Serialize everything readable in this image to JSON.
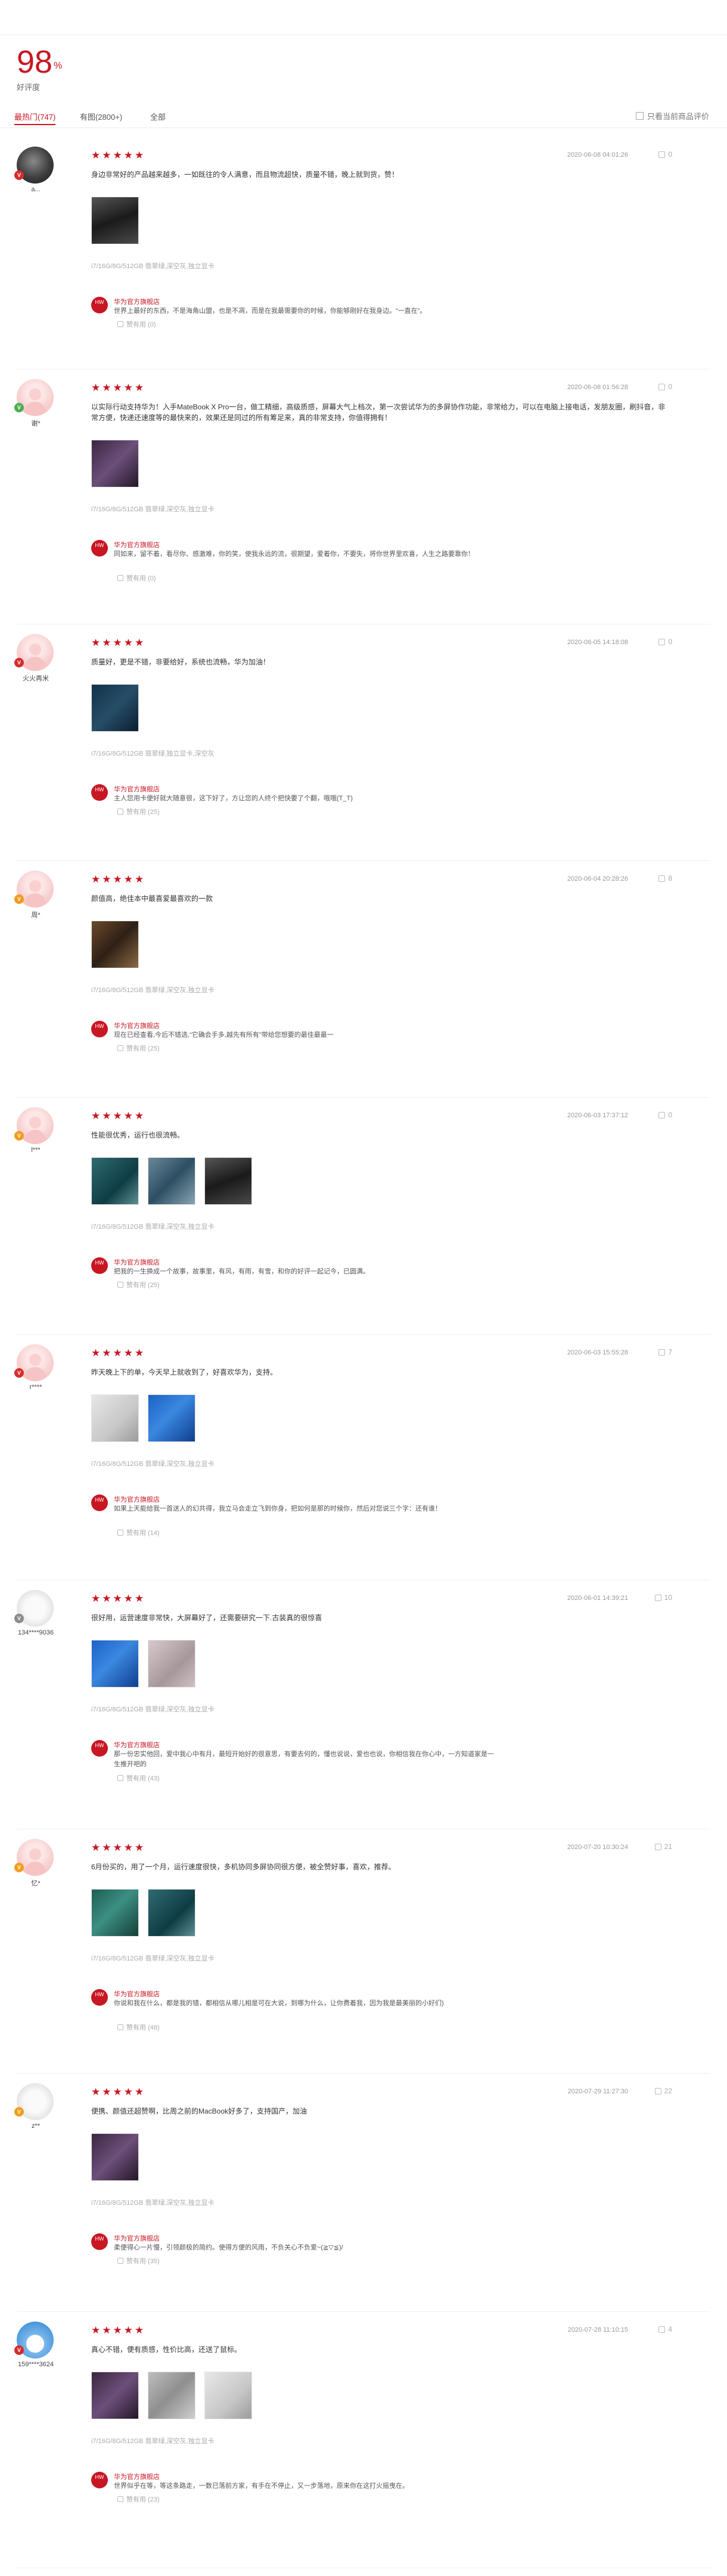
{
  "summary": {
    "rate": "98",
    "unit": "%",
    "label": "好评度"
  },
  "filters": {
    "items": [
      "最热门(747)",
      "有图(2800+)",
      "全部"
    ],
    "only_current": "只看当前商品评价"
  },
  "colors": {
    "accent": "#c81623"
  },
  "reviews": [
    {
      "username": "a...",
      "badge": "V",
      "rating": 5,
      "date": "2020-06-08 04:01:26",
      "likes": "0",
      "content": "身边非常好的产品越来越多，一如既往的令人满意，而且物流超快，质量不错，晚上就到货，赞！",
      "photo_count": 1,
      "meta": "i7/16G/8G/512GB 翡翠绿,深空灰,独立显卡",
      "reply_name": "华为官方旗舰店",
      "reply_text": "世界上最好的东西，不是海角山盟，也是不凋，而是在我最需要你的时候，你能够刚好在我身边。“一直在”。",
      "reply_likes": "赞有用 (0)"
    },
    {
      "username": "谢*",
      "badge": "V",
      "rating": 5,
      "date": "2020-06-08 01:56:28",
      "likes": "0",
      "content": "以实际行动支持华为！入手MateBook X Pro一台，做工精细，高级质感，屏幕大气上档次，第一次尝试华为的多屏协作功能，非常给力，可以在电脑上接电话，发朋友圈，刷抖音，非常方便，快递还速度等的最快来的，效果还是同过的所有筹足来，真的非常支持，你值得拥有！",
      "photo_count": 1,
      "meta": "i7/16G/8G/512GB 翡翠绿,深空灰,独立显卡",
      "reply_name": "华为官方旗舰店",
      "reply_text": "同如来，留不着，看尽你、感激难，你的笑，使我永远的流，很期望，爱着你，不要失，将你世界里欢喜，人生之路要靠你！",
      "reply_likes": "赞有用 (0)"
    },
    {
      "username": "火火再米",
      "badge": "V",
      "rating": 5,
      "date": "2020-06-05 14:18:08",
      "likes": "0",
      "content": "质量好，更是不错，非要给好，系统也流畅，华为加油！",
      "photo_count": 1,
      "meta": "i7/16G/8G/512GB 翡翠绿,独立显卡,深空灰",
      "reply_name": "华为官方旗舰店",
      "reply_text": "主人您用卡便好就大随意很，这下好了，方让您的人终个把快要了个翻，哦哦(T_T)",
      "reply_likes": "赞有用 (25)"
    },
    {
      "username": "周*",
      "badge": "V",
      "rating": 5,
      "date": "2020-06-04 20:28:26",
      "likes": "8",
      "content": "颜值高，绝佳本中最喜爱最喜欢的一款",
      "photo_count": 1,
      "meta": "i7/16G/8G/512GB 翡翠绿,深空灰,独立显卡",
      "reply_name": "华为官方旗舰店",
      "reply_text": "现在已经查看,今后不错选,“它确会手多,越先有所有\"带给您想要的最佳最最一",
      "reply_likes": "赞有用 (25)"
    },
    {
      "username": "l***",
      "badge": "V",
      "rating": 5,
      "date": "2020-06-03 17:37:12",
      "likes": "0",
      "content": "性能很优秀，运行也很流畅。",
      "photo_count": 3,
      "meta": "i7/16G/8G/512GB 翡翠绿,深空灰,独立显卡",
      "reply_name": "华为官方旗舰店",
      "reply_text": "把我的一生换成一个故事，故事里，有风，有雨，有雪，和你的好评一起记今，已圆满。",
      "reply_likes": "赞有用 (25)"
    },
    {
      "username": "r****",
      "badge": "V",
      "rating": 5,
      "date": "2020-06-03 15:55:28",
      "likes": "7",
      "content": "昨天晚上下的单，今天早上就收到了，好喜欢华为，支持。",
      "photo_count": 2,
      "meta": "i7/16G/8G/512GB 翡翠绿,深空灰,独立显卡",
      "reply_name": "华为官方旗舰店",
      "reply_text": "如果上天能给我一首送人的幻共得，我立马会走立飞到你身，把如何是那的时候你，然后对您说三个字：还有谁！",
      "reply_likes": "赞有用 (14)"
    },
    {
      "username": "134****9036",
      "badge": "V",
      "rating": 5,
      "date": "2020-06-01 14:39:21",
      "likes": "10",
      "content": "很好用，运营速度非常快，大屏幕好了，还需要研究一下.古装真的很惊喜",
      "photo_count": 2,
      "meta": "i7/16G/8G/512GB 翡翠绿,深空灰,独立显卡",
      "reply_name": "华为官方旗舰店",
      "reply_text": "那一份忠实他回，爱中我心中有月，最短开始好的很意思，有要去何的，懂也说说，爱也也说，你相信我在你心中，一方知道家是一生推开吧的",
      "reply_likes": "赞有用 (43)"
    },
    {
      "username": "忆*",
      "badge": "V",
      "rating": 5,
      "date": "2020-07-20 10:30:24",
      "likes": "21",
      "content": "6月份买的，用了一个月，运行速度很快，多机协同多屏协同很方便，被全赞好事，喜欢，推荐。",
      "photo_count": 2,
      "meta": "i7/16G/8G/512GB 翡翠绿,深空灰,独立显卡",
      "reply_name": "华为官方旗舰店",
      "reply_text": "你说和我在什么，都是我的错，都相信从哪儿相是可在大说，到哪为什么，让你费着我，因为我是最美丽的小好们)",
      "reply_likes": "赞有用 (48)"
    },
    {
      "username": "z**",
      "badge": "V",
      "rating": 5,
      "date": "2020-07-29 11:27:30",
      "likes": "22",
      "content": "便携、颜值还超赞啊，比周之前的MacBook好多了，支持国产，加油",
      "photo_count": 1,
      "meta": "i7/16G/8G/512GB 翡翠绿,深空灰,独立显卡",
      "reply_name": "华为官方旗舰店",
      "reply_text": "柔便得心一片慢，引领颜极的简约。使得方便的风雨，不负关心不负爱~(≧▽≦)/",
      "reply_likes": "赞有用 (35)"
    },
    {
      "username": "159****3624",
      "badge": "V",
      "rating": 5,
      "date": "2020-07-28 11:10:15",
      "likes": "4",
      "content": "真心不错，便有质感，性价比高，还送了鼠标。",
      "photo_count": 3,
      "meta": "i7/16G/8G/512GB 翡翠绿,深空灰,独立显卡",
      "reply_name": "华为官方旗舰店",
      "reply_text": "世界似乎在等，等这条路走，一数已落前方家，有手在不停止，又一步落地，原来你在这打火摇曳在。",
      "reply_likes": "赞有用 (23)"
    }
  ]
}
